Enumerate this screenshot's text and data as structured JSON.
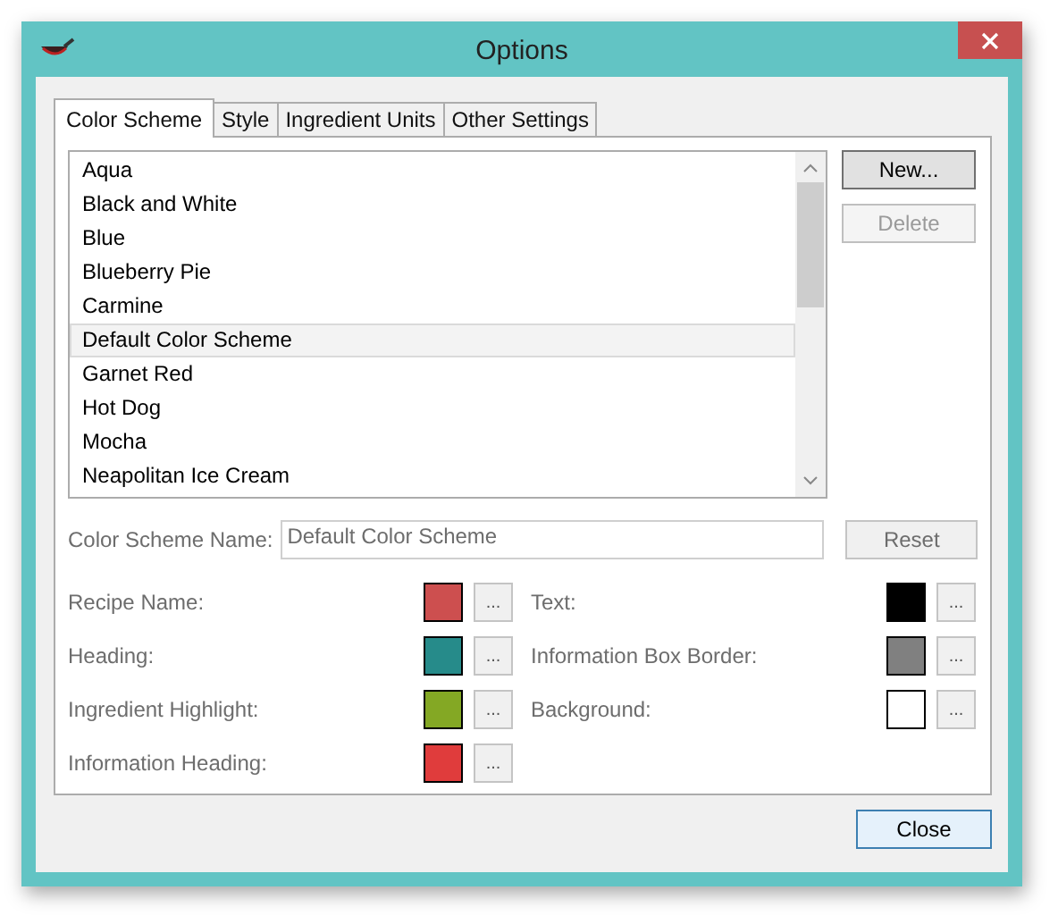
{
  "window": {
    "title": "Options"
  },
  "tabs": [
    {
      "label": "Color Scheme",
      "selected": true
    },
    {
      "label": "Style",
      "selected": false
    },
    {
      "label": "Ingredient Units",
      "selected": false
    },
    {
      "label": "Other Settings",
      "selected": false
    }
  ],
  "schemes": [
    {
      "name": "Aqua",
      "selected": false
    },
    {
      "name": "Black and White",
      "selected": false
    },
    {
      "name": "Blue",
      "selected": false
    },
    {
      "name": "Blueberry Pie",
      "selected": false
    },
    {
      "name": "Carmine",
      "selected": false
    },
    {
      "name": "Default Color Scheme",
      "selected": true
    },
    {
      "name": "Garnet Red",
      "selected": false
    },
    {
      "name": "Hot Dog",
      "selected": false
    },
    {
      "name": "Mocha",
      "selected": false
    },
    {
      "name": "Neapolitan Ice Cream",
      "selected": false
    }
  ],
  "side_buttons": [
    {
      "label": "New...",
      "disabled": false
    },
    {
      "label": "Delete",
      "disabled": true
    }
  ],
  "name_field": {
    "label": "Color Scheme Name:",
    "value": "Default Color Scheme"
  },
  "reset_button": {
    "label": "Reset"
  },
  "colors_left": [
    {
      "label": "Recipe Name:",
      "color": "#cd4f4f",
      "button": "..."
    },
    {
      "label": "Heading:",
      "color": "#268b8a",
      "button": "..."
    },
    {
      "label": "Ingredient Highlight:",
      "color": "#84a824",
      "button": "..."
    },
    {
      "label": "Information Heading:",
      "color": "#e03c3c",
      "button": "..."
    }
  ],
  "colors_right": [
    {
      "label": "Text:",
      "color": "#000000",
      "button": "..."
    },
    {
      "label": "Information Box Border:",
      "color": "#808080",
      "button": "..."
    },
    {
      "label": "Background:",
      "color": "#ffffff",
      "button": "..."
    }
  ],
  "close_button": {
    "label": "Close"
  }
}
